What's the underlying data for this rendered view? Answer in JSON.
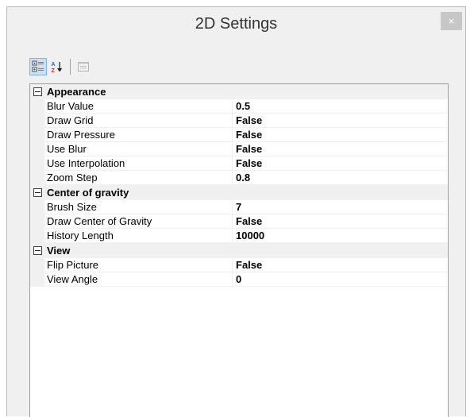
{
  "window": {
    "title": "2D Settings",
    "close_label": "×"
  },
  "toolbar": {
    "buttons": [
      {
        "name": "categorized-icon",
        "active": true
      },
      {
        "name": "alphabetical-sort-icon",
        "active": false
      },
      {
        "name": "property-pages-icon",
        "active": false
      }
    ]
  },
  "grid": {
    "categories": [
      {
        "label": "Appearance",
        "properties": [
          {
            "name": "Blur Value",
            "value": "0.5"
          },
          {
            "name": "Draw Grid",
            "value": "False"
          },
          {
            "name": "Draw Pressure",
            "value": "False"
          },
          {
            "name": "Use Blur",
            "value": "False"
          },
          {
            "name": "Use Interpolation",
            "value": "False"
          },
          {
            "name": "Zoom Step",
            "value": "0.8"
          }
        ]
      },
      {
        "label": "Center of gravity",
        "properties": [
          {
            "name": "Brush Size",
            "value": "7"
          },
          {
            "name": "Draw Center of Gravity",
            "value": "False"
          },
          {
            "name": "History Length",
            "value": "10000"
          }
        ]
      },
      {
        "label": "View",
        "properties": [
          {
            "name": "Flip Picture",
            "value": "False"
          },
          {
            "name": "View Angle",
            "value": "0"
          }
        ]
      }
    ]
  },
  "colors": {
    "window_bg": "#f0f0f0",
    "active_button_bg": "#c9e0f7",
    "close_button_bg": "#c7c7c7"
  }
}
